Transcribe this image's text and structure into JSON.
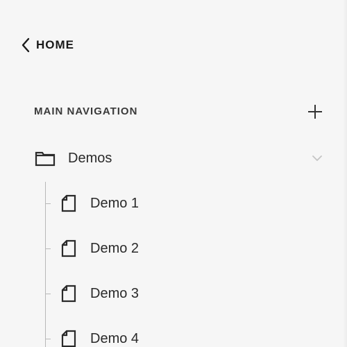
{
  "header": {
    "back_label": "HOME",
    "back_icon": "chevron-left-icon"
  },
  "navigation": {
    "section_title": "MAIN NAVIGATION",
    "add_icon": "plus-icon",
    "folder": {
      "label": "Demos",
      "icon": "folder-icon",
      "expanded": true,
      "chevron_icon": "chevron-down-icon",
      "items": [
        {
          "label": "Demo 1",
          "icon": "page-icon"
        },
        {
          "label": "Demo 2",
          "icon": "page-icon"
        },
        {
          "label": "Demo 3",
          "icon": "page-icon"
        },
        {
          "label": "Demo 4",
          "icon": "page-icon"
        }
      ]
    }
  },
  "colors": {
    "background": "#f6f6f6",
    "text": "#2a2a2a",
    "tree_line": "#b8b8b8",
    "chevron_muted": "#c4c4c4"
  }
}
